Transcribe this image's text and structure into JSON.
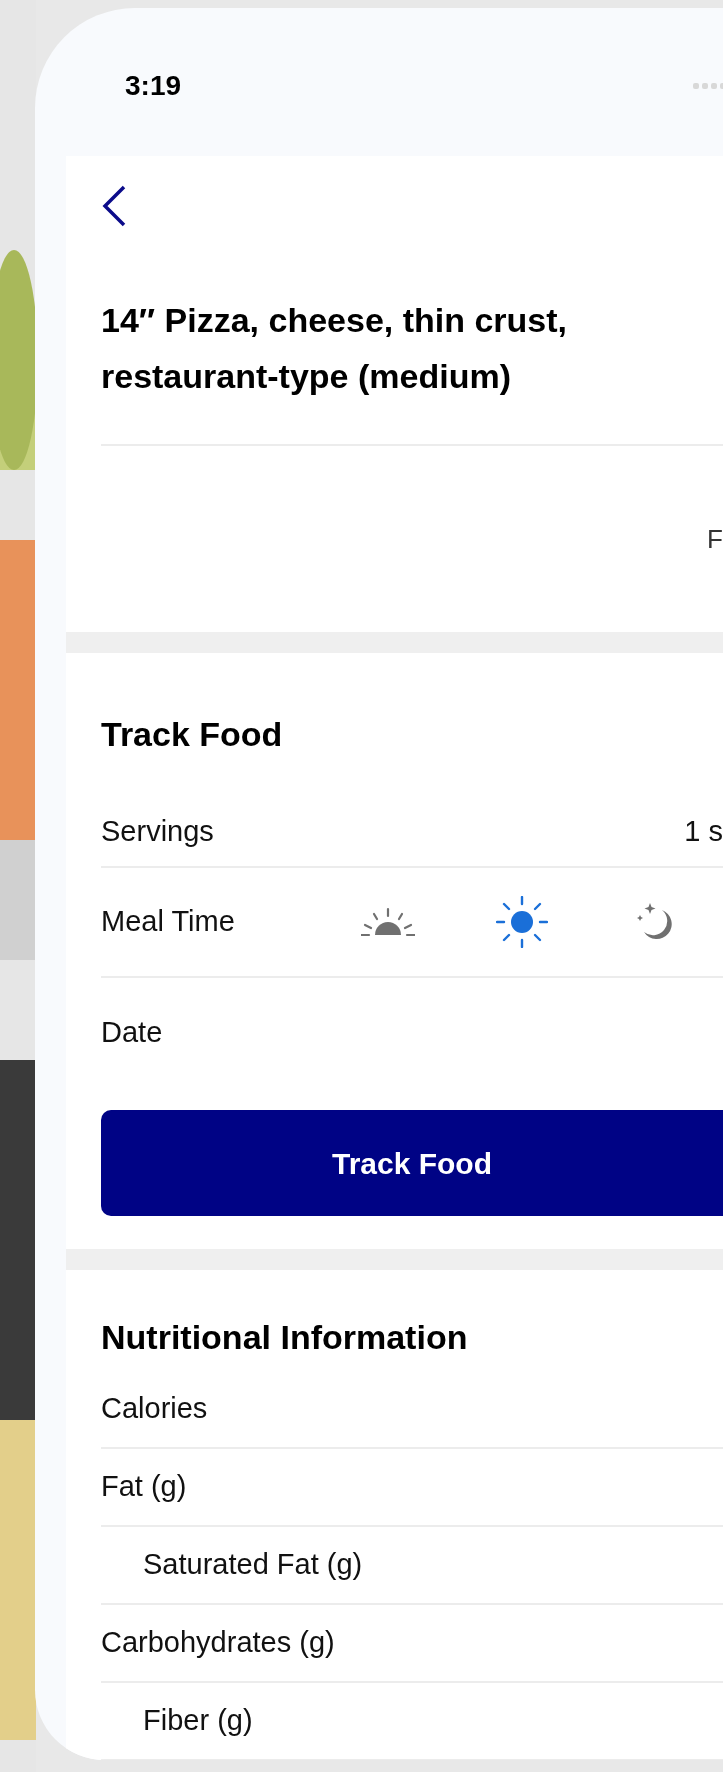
{
  "status_bar": {
    "time": "3:19"
  },
  "food": {
    "title": "14″ Pizza, cheese, thin crust, restaurant-type (medium)",
    "text_1": "F"
  },
  "track_food": {
    "heading": "Track Food",
    "servings": {
      "label": "Servings",
      "value": "1 s"
    },
    "meal_time": {
      "label": "Meal Time",
      "options": [
        {
          "kind": "sunrise",
          "selected": false
        },
        {
          "kind": "sun",
          "selected": true
        },
        {
          "kind": "moon",
          "selected": false
        }
      ]
    },
    "date": {
      "label": "Date"
    },
    "button": "Track Food"
  },
  "nutrition": {
    "heading": "Nutritional Information",
    "rows": [
      {
        "label": "Calories",
        "children": []
      },
      {
        "label": "Fat (g)",
        "children": [
          {
            "label": "Saturated Fat (g)"
          }
        ]
      },
      {
        "label": "Carbohydrates (g)",
        "children": [
          {
            "label": "Fiber (g)"
          }
        ]
      }
    ]
  }
}
